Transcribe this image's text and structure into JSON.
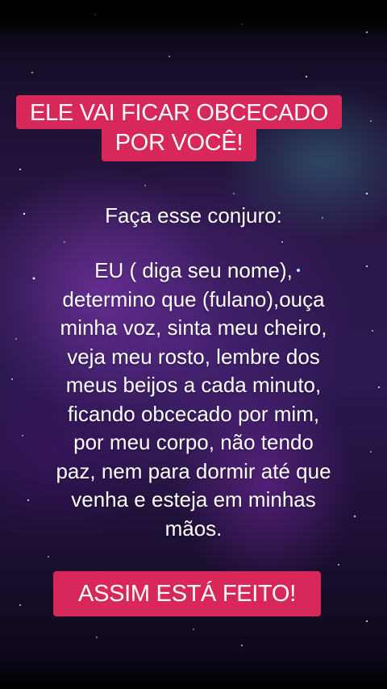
{
  "title": {
    "line1": "ELE VAI FICAR OBCECADO",
    "line2": "POR VOCÊ!"
  },
  "intro": "Faça esse conjuro:",
  "spell_lines": [
    "EU ( diga seu nome),",
    "determino que (fulano),ouça",
    "minha voz, sinta meu cheiro,",
    "veja meu rosto, lembre dos",
    "meus beijos a cada minuto,",
    "ficando obcecado por mim,",
    "por meu corpo, não tendo",
    "paz, nem para dormir até que",
    "venha e esteja em minhas",
    "mãos."
  ],
  "footer": "ASSIM ESTÁ FEITO!",
  "colors": {
    "label_background": "#d8285a",
    "text": "#ffffff",
    "background": "#2a1748"
  }
}
